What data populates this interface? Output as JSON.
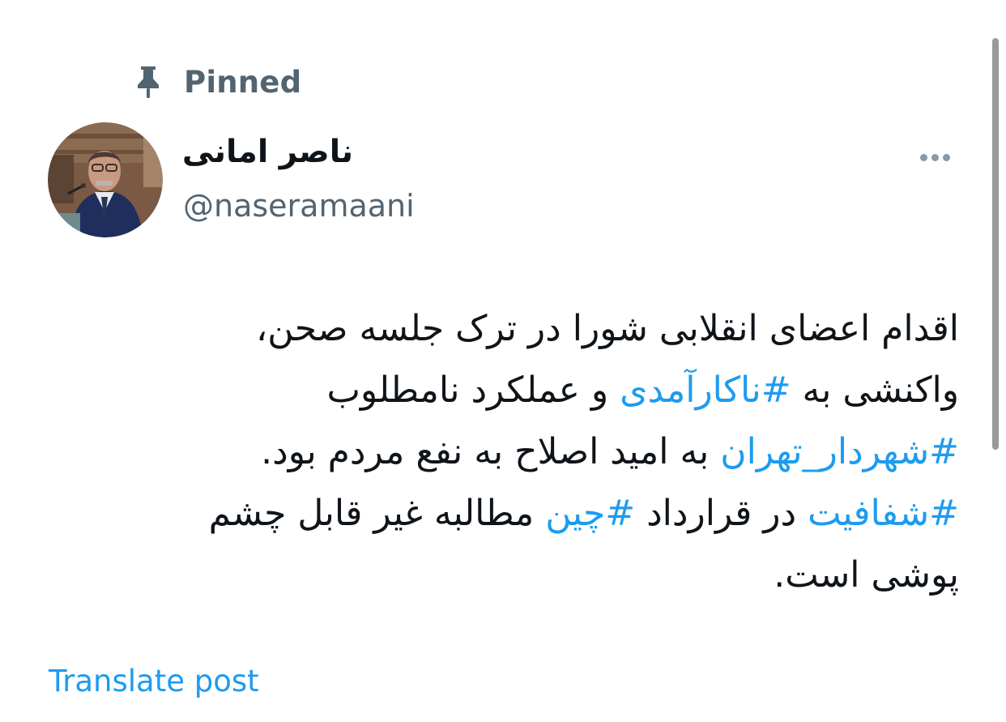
{
  "pinned": {
    "label": "Pinned",
    "icon": "pin-icon"
  },
  "author": {
    "display_name": "ناصر امانی",
    "handle": "@naseramaani",
    "avatar_icon": "avatar"
  },
  "more_icon": "more-horizontal-icon",
  "tweet": {
    "lines": [
      [
        {
          "text": "اقدام اعضای انقلابی شورا در ترک جلسه صحن،",
          "hashtag": false
        }
      ],
      [
        {
          "text": "واکنشی به ",
          "hashtag": false
        },
        {
          "text": "#ناکارآمدی",
          "hashtag": true
        },
        {
          "text": " و عملکرد نامطلوب",
          "hashtag": false
        }
      ],
      [
        {
          "text": "#شهردار_تهران",
          "hashtag": true
        },
        {
          "text": " به امید اصلاح به نفع مردم بود.",
          "hashtag": false
        }
      ],
      [
        {
          "text": "#شفافیت",
          "hashtag": true
        },
        {
          "text": " در قرارداد ",
          "hashtag": false
        },
        {
          "text": "#چین",
          "hashtag": true
        },
        {
          "text": " مطالبه غیر قابل چشم",
          "hashtag": false
        }
      ],
      [
        {
          "text": "پوشی است.",
          "hashtag": false
        }
      ]
    ]
  },
  "translate_label": "Translate post",
  "colors": {
    "text": "#0f1419",
    "secondary": "#536471",
    "link": "#1d9bf0",
    "background": "#ffffff"
  }
}
